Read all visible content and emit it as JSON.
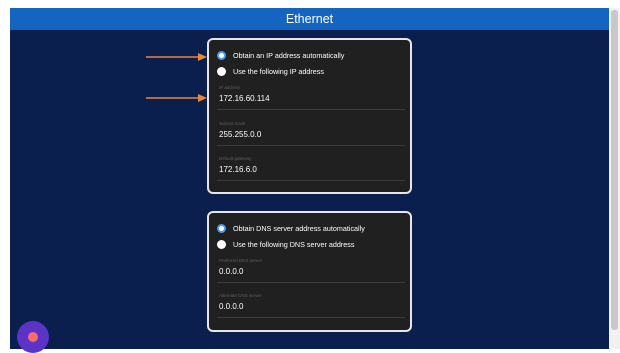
{
  "window": {
    "title": "Ethernet"
  },
  "ip": {
    "options": [
      {
        "label": "Obtain an IP address automatically",
        "selected": true
      },
      {
        "label": "Use the following IP address",
        "selected": false
      }
    ],
    "fields": [
      {
        "label": "IP address",
        "value": "172.16.60.114"
      },
      {
        "label": "Subnet mask",
        "value": "255.255.0.0"
      },
      {
        "label": "Default gateway",
        "value": "172.16.6.0"
      }
    ]
  },
  "dns": {
    "options": [
      {
        "label": "Obtain DNS server address automatically",
        "selected": true
      },
      {
        "label": "Use the following DNS server address",
        "selected": false
      }
    ],
    "fields": [
      {
        "label": "Preferred DNS server",
        "value": "0.0.0.0"
      },
      {
        "label": "Alternate DNS server",
        "value": "0.0.0.0"
      }
    ]
  },
  "colors": {
    "background": "#0b1f4e",
    "titlebar": "#1565c0",
    "panel": "#202020",
    "accent": "#4a9ef0",
    "annotation_arrow": "#e8893a"
  },
  "icons": {
    "fab": "assistant-icon"
  }
}
